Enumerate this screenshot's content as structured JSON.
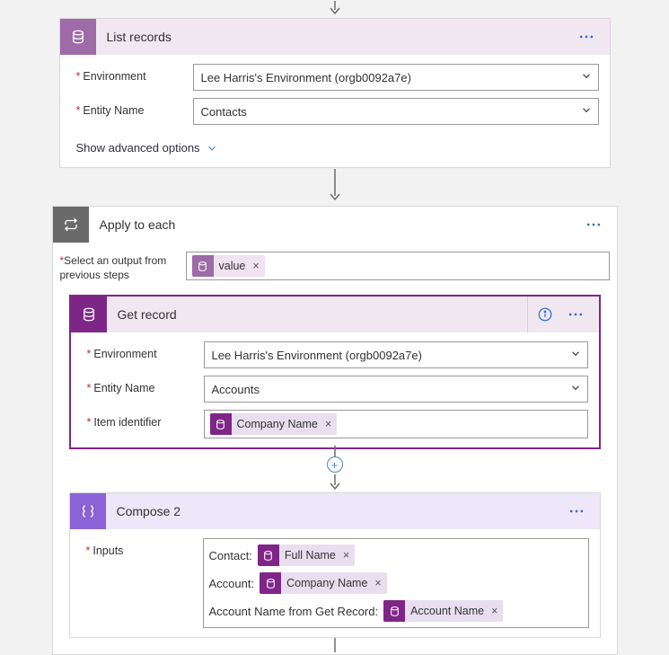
{
  "actions": {
    "list_records": {
      "title": "List records",
      "fields": {
        "environment_label": "Environment",
        "environment_value": "Lee Harris's Environment (orgb0092a7e)",
        "entity_label": "Entity Name",
        "entity_value": "Contacts"
      },
      "advanced_label": "Show advanced options"
    },
    "apply_each": {
      "title": "Apply to each",
      "select_label": "Select an output from previous steps",
      "token_value": "value"
    },
    "get_record": {
      "title": "Get record",
      "fields": {
        "environment_label": "Environment",
        "environment_value": "Lee Harris's Environment (orgb0092a7e)",
        "entity_label": "Entity Name",
        "entity_value": "Accounts",
        "item_id_label": "Item identifier",
        "item_id_token": "Company Name"
      }
    },
    "compose": {
      "title": "Compose 2",
      "inputs_label": "Inputs",
      "lines": {
        "line1_prefix": "Contact:",
        "line1_token": "Full Name",
        "line2_prefix": "Account:",
        "line2_token": "Company Name",
        "line3_prefix": "Account Name from Get Record:",
        "line3_token": "Account Name"
      }
    }
  },
  "glyphs": {
    "asterisk": "*",
    "times": "×",
    "plus": "+"
  }
}
